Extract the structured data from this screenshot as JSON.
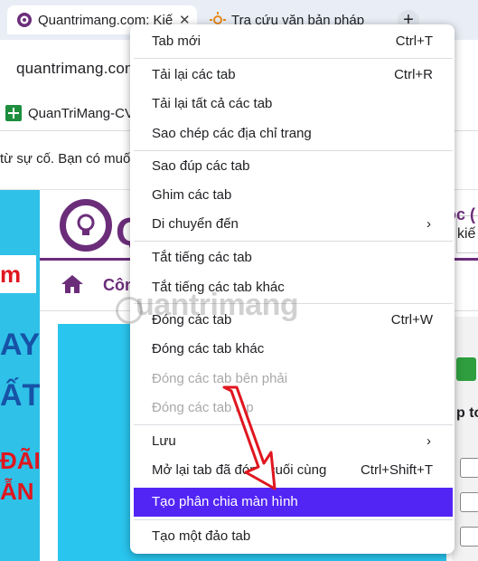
{
  "tabs": [
    {
      "title": "Quantrimang.com: Kiế",
      "close": "✕"
    },
    {
      "title": "Tra cứu văn bản pháp luật"
    }
  ],
  "new_tab_glyph": "+",
  "address": {
    "url": "quantrimang.com"
  },
  "bookmark": {
    "label": "QuanTriMang-CV"
  },
  "infobar": {
    "text": "từ sự cố. Bạn có muốn"
  },
  "page": {
    "ad_left_red": "m",
    "ad_left_blue1": "AY",
    "ad_left_blue2": "ẤT",
    "ad_left_red2": "ĐÃI",
    "ad_left_red3": "ẪN",
    "logo_letter": "Q",
    "nav_label": "Côn",
    "nav_right": "ọc (",
    "search_text": "kiế",
    "right_text": "p to"
  },
  "menu": {
    "items": [
      {
        "label": "Tab mới",
        "shortcut": "Ctrl+T"
      },
      {
        "label": "Tải lại các tab",
        "shortcut": "Ctrl+R"
      },
      {
        "label": "Tải lại tất cả các tab",
        "shortcut": ""
      },
      {
        "label": "Sao chép các địa chỉ trang",
        "shortcut": ""
      },
      {
        "label": "Sao đúp các tab",
        "shortcut": ""
      },
      {
        "label": "Ghim các tab",
        "shortcut": ""
      },
      {
        "label": "Di chuyển đến",
        "shortcut": "",
        "submenu": "›"
      },
      {
        "label": "Tắt tiếng các tab",
        "shortcut": ""
      },
      {
        "label": "Tắt tiếng các tab khác",
        "shortcut": ""
      },
      {
        "label": "Đóng các tab",
        "shortcut": "Ctrl+W"
      },
      {
        "label": "Đóng các tab khác",
        "shortcut": ""
      },
      {
        "label": "Đóng các tab bên phải",
        "shortcut": "",
        "disabled": true
      },
      {
        "label": "Đóng các tab lặp",
        "shortcut": "",
        "disabled": true
      },
      {
        "label": "Lưu",
        "shortcut": "",
        "submenu": "›"
      },
      {
        "label": "Mở lại tab đã đóng cuối cùng",
        "shortcut": "Ctrl+Shift+T"
      },
      {
        "label": "Tạo phân chia màn hình",
        "shortcut": "",
        "highlighted": true
      },
      {
        "label": "Tạo một đảo tab",
        "shortcut": ""
      }
    ]
  },
  "watermark": "uantrimang",
  "colors": {
    "highlight": "#5225f5",
    "brand": "#6b2d7a",
    "arrow": "#e0161f"
  }
}
